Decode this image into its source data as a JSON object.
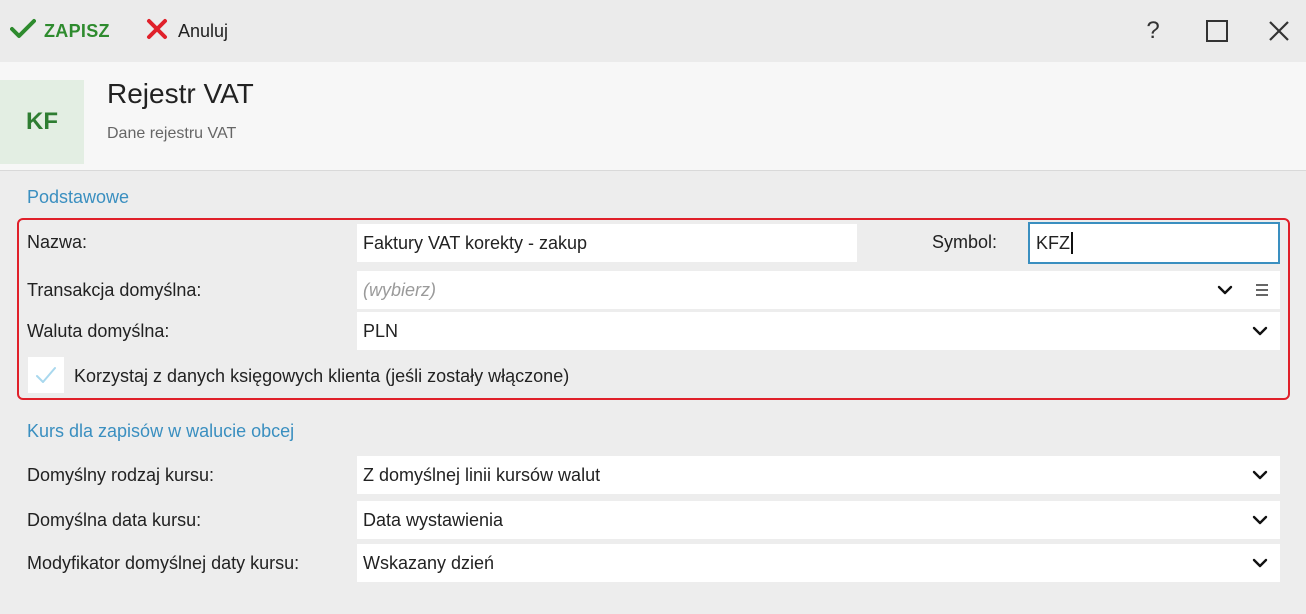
{
  "toolbar": {
    "save_label": "ZAPISZ",
    "cancel_label": "Anuluj",
    "help_label": "?"
  },
  "header": {
    "badge": "KF",
    "title": "Rejestr VAT",
    "subtitle": "Dane rejestru VAT"
  },
  "basic": {
    "section_title": "Podstawowe",
    "name_label": "Nazwa:",
    "name_value": "Faktury VAT korekty - zakup",
    "symbol_label": "Symbol:",
    "symbol_value": "KFZ",
    "transaction_label": "Transakcja domyślna:",
    "transaction_placeholder": "(wybierz)",
    "currency_label": "Waluta domyślna:",
    "currency_value": "PLN",
    "checkbox_label": "Korzystaj z danych księgowych klienta (jeśli zostały włączone)",
    "checkbox_checked": false
  },
  "rate": {
    "section_title": "Kurs dla zapisów w walucie obcej",
    "type_label": "Domyślny rodzaj kursu:",
    "type_value": "Z domyślnej linii kursów walut",
    "date_label": "Domyślna data kursu:",
    "date_value": "Data wystawienia",
    "modifier_label": "Modyfikator domyślnej daty kursu:",
    "modifier_value": "Wskazany dzień"
  },
  "colors": {
    "accent_blue": "#3a8fc0",
    "save_green": "#2e8b2e",
    "cancel_red": "#e0202a",
    "highlight_border": "#e0202a"
  }
}
